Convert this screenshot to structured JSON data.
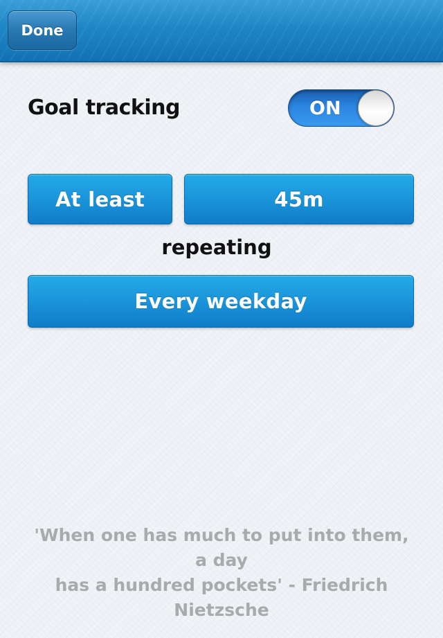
{
  "navbar": {
    "done_label": "Done"
  },
  "goal": {
    "label": "Goal tracking",
    "toggle_state": "ON"
  },
  "target": {
    "comparator_label": "At least",
    "duration_label": "45m"
  },
  "repeat": {
    "label": "repeating",
    "frequency_label": "Every weekday"
  },
  "quote": {
    "line1": "'When one has much to put into them, a day",
    "line2": "has a hundred pockets' - Friedrich Nietzsche"
  },
  "colors": {
    "accent": "#1a94da",
    "navbar": "#1f86c6",
    "background": "#eef1f5",
    "quote_text": "#a8aaad"
  }
}
